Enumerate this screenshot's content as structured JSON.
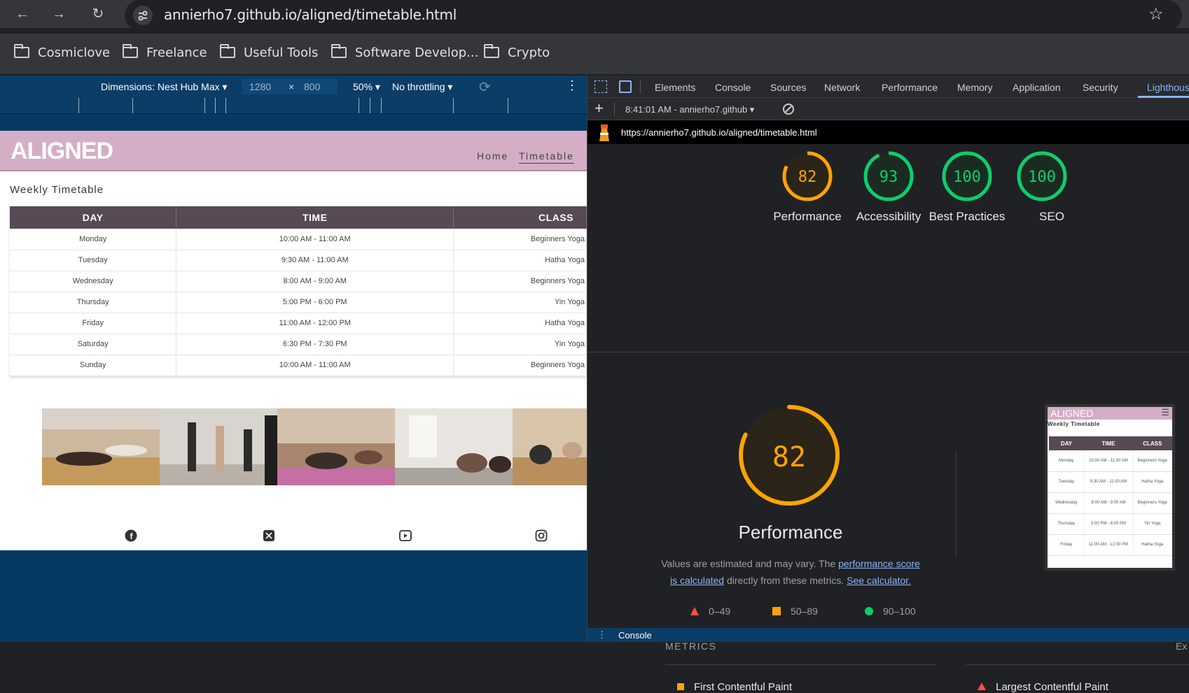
{
  "browser": {
    "url": "annierho7.github.io/aligned/timetable.html",
    "bookmarks": [
      "Cosmiclove",
      "Freelance",
      "Useful Tools",
      "Software Develop...",
      "Crypto"
    ]
  },
  "device_toolbar": {
    "dimensions": "Dimensions: Nest Hub Max",
    "width": "1280",
    "times": "×",
    "height": "800",
    "zoom": "50%",
    "throttling": "No throttling"
  },
  "site": {
    "logo": "ALIGNED",
    "nav": [
      "Home",
      "Timetable"
    ],
    "heading": "Weekly Timetable",
    "table": {
      "headers": [
        "DAY",
        "TIME",
        "CLASS"
      ],
      "rows": [
        [
          "Monday",
          "10:00 AM - 11:00 AM",
          "Beginners Yoga"
        ],
        [
          "Tuesday",
          "9:30 AM - 11:00 AM",
          "Hatha Yoga"
        ],
        [
          "Wednesday",
          "8:00 AM - 9:00 AM",
          "Beginners Yoga"
        ],
        [
          "Thursday",
          "5:00 PM - 6:00 PM",
          "Yin Yoga"
        ],
        [
          "Friday",
          "11:00 AM - 12:00 PM",
          "Hatha Yoga"
        ],
        [
          "Saturday",
          "6:30 PM - 7:30 PM",
          "Yin Yoga"
        ],
        [
          "Sunday",
          "10:00 AM - 11:00 AM",
          "Beginners Yoga"
        ]
      ]
    },
    "social_icons": [
      "facebook-icon",
      "x-icon",
      "youtube-icon",
      "instagram-icon"
    ]
  },
  "devtools": {
    "tabs": [
      "Elements",
      "Console",
      "Sources",
      "Network",
      "Performance",
      "Memory",
      "Application",
      "Security",
      "Lighthous"
    ],
    "report_label": "8:41:01 AM - annierho7.github",
    "report_url": "https://annierho7.github.io/aligned/timetable.html",
    "scores": [
      {
        "value": 82,
        "label": "Performance",
        "color": "#ffa400"
      },
      {
        "value": 93,
        "label": "Accessibility",
        "color": "#0cce6b"
      },
      {
        "value": 100,
        "label": "Best Practices",
        "color": "#0cce6b"
      },
      {
        "value": 100,
        "label": "SEO",
        "color": "#0cce6b"
      }
    ],
    "perf": {
      "score": "82",
      "title": "Performance",
      "desc_1": "Values are estimated and may vary. The ",
      "link_1": "performance score is calculated",
      "desc_2": " directly from these metrics. ",
      "link_2": "See calculator."
    },
    "legend": [
      "0–49",
      "50–89",
      "90–100"
    ],
    "metrics_header": "METRICS",
    "expand": "Ex",
    "metrics": [
      "First Contentful Paint",
      "Largest Contentful Paint"
    ],
    "console_label": "Console",
    "thumbnail": {
      "logo": "ALIGNED",
      "heading": "Weekly Timetable",
      "headers": [
        "DAY",
        "TIME",
        "CLASS"
      ],
      "rows": [
        [
          "Monday",
          "10:00 AM - 11:00 AM",
          "Beginners Yoga"
        ],
        [
          "Tuesday",
          "9:30 AM - 11:00 AM",
          "Hatha Yoga"
        ],
        [
          "Wednesday",
          "8:00 AM - 9:00 AM",
          "Beginners Yoga"
        ],
        [
          "Thursday",
          "5:00 PM - 6:00 PM",
          "Yin Yoga"
        ],
        [
          "Friday",
          "11:00 AM - 12:00 PM",
          "Hatha Yoga"
        ]
      ]
    }
  }
}
